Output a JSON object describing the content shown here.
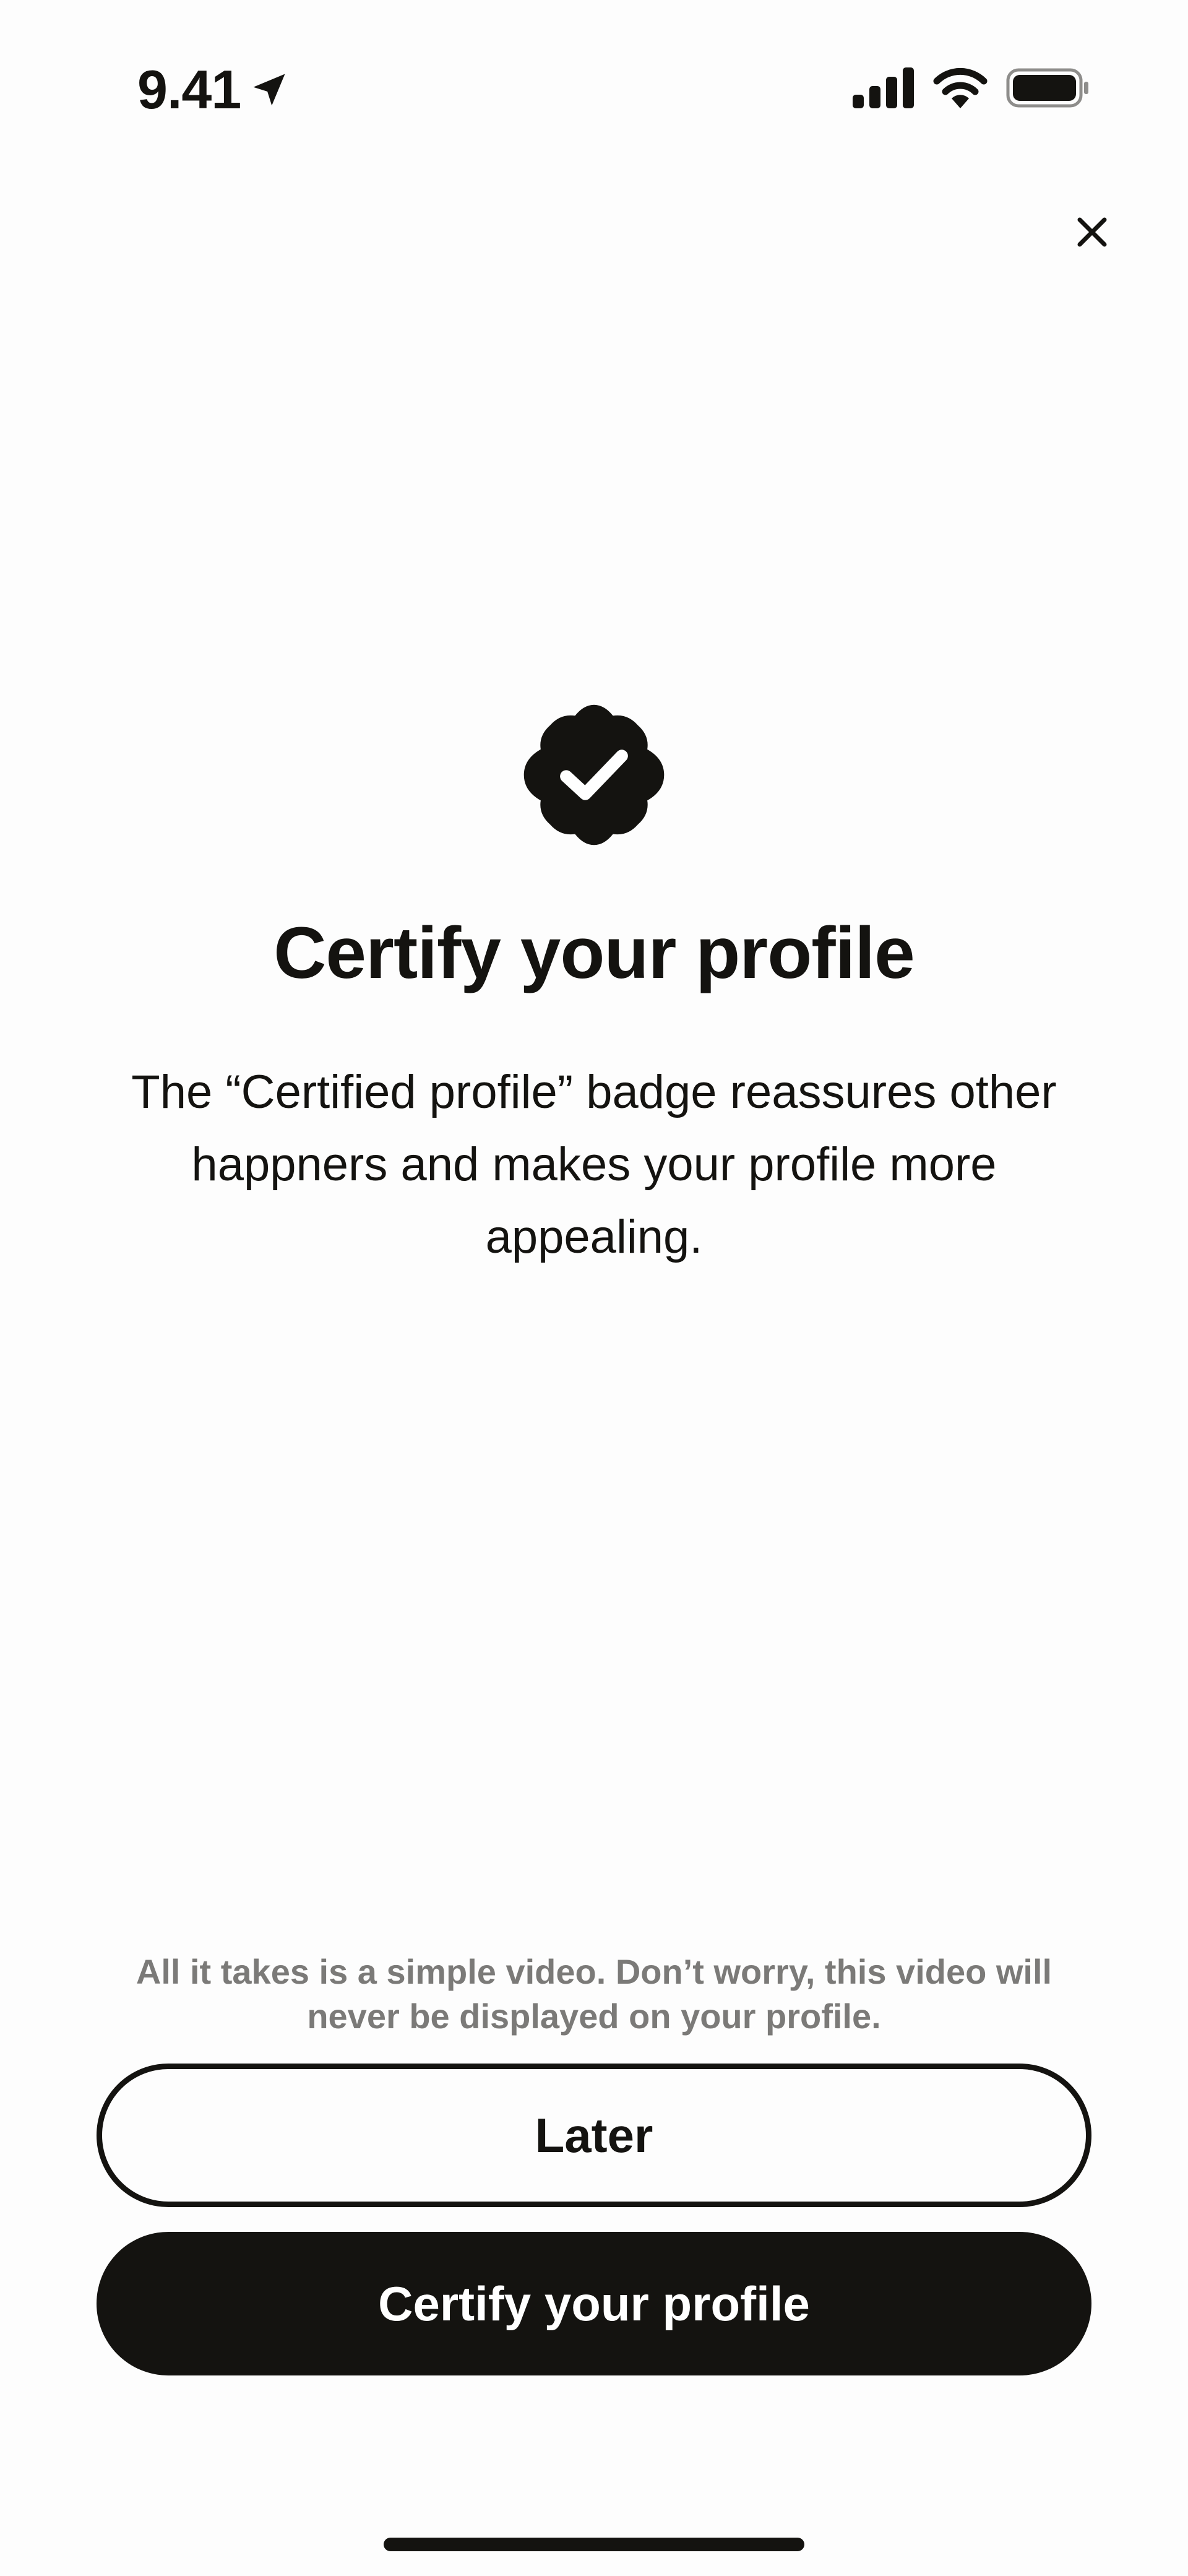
{
  "status_bar": {
    "time": "9.41",
    "icons": [
      "location-arrow-icon",
      "cellular-signal-icon",
      "wifi-icon",
      "battery-icon"
    ]
  },
  "header": {
    "close_icon": "close-icon"
  },
  "main": {
    "badge_icon": "verified-badge-icon",
    "title": "Certify your profile",
    "description": "The “Certified profile” badge reassures other happners and makes your profile more appealing."
  },
  "footer": {
    "note": "All it takes is a simple video. Don’t worry, this video will never be displayed on your profile.",
    "later_label": "Later",
    "certify_label": "Certify your profile"
  },
  "colors": {
    "primary": "#141310",
    "background": "#fdfdfd",
    "note_text": "#7b7a78"
  }
}
